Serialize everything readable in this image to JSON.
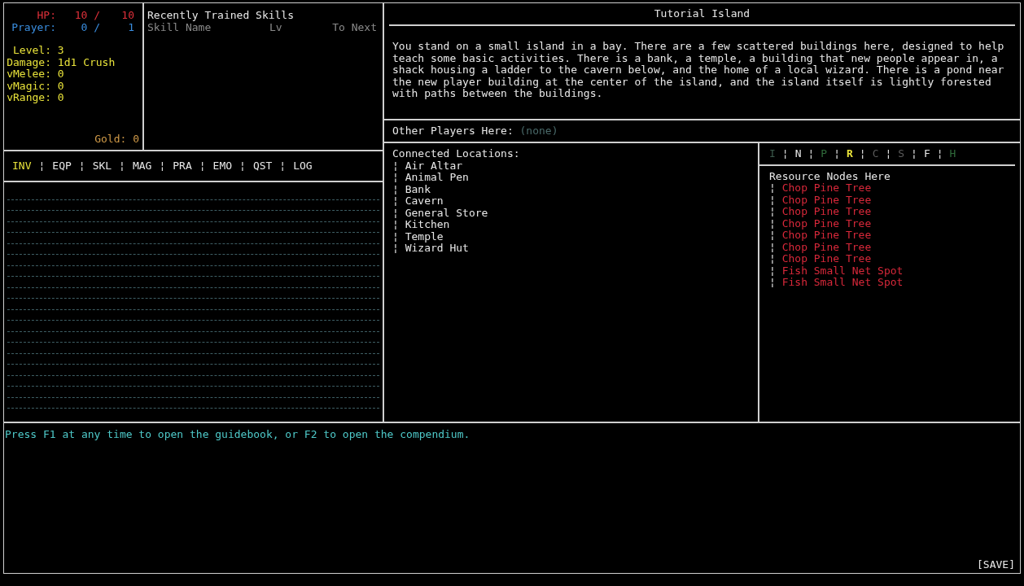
{
  "stats": {
    "hp": {
      "label": "HP:",
      "current": "10 /",
      "max": "10"
    },
    "prayer": {
      "label": "Prayer:",
      "current": "0 /",
      "max": "1"
    },
    "attributes": [
      {
        "label": "Level:",
        "value": "3"
      },
      {
        "label": "Damage:",
        "value": "1d1 Crush"
      },
      {
        "label": "vMelee:",
        "value": "0"
      },
      {
        "label": "vMagic:",
        "value": "0"
      },
      {
        "label": "vRange:",
        "value": "0"
      }
    ],
    "gold": {
      "label": "Gold:",
      "value": "0"
    }
  },
  "skills": {
    "title": "Recently Trained Skills",
    "columns": [
      "Skill Name",
      "Lv",
      "To Next"
    ]
  },
  "tabs": {
    "separator": "¦",
    "items": [
      {
        "label": "INV",
        "selected": true
      },
      {
        "label": "EQP",
        "selected": false
      },
      {
        "label": "SKL",
        "selected": false
      },
      {
        "label": "MAG",
        "selected": false
      },
      {
        "label": "PRA",
        "selected": false
      },
      {
        "label": "EMO",
        "selected": false
      },
      {
        "label": "QST",
        "selected": false
      },
      {
        "label": "LOG",
        "selected": false
      }
    ]
  },
  "location": {
    "title": "Tutorial Island",
    "description": "You stand on a small island in a bay. There are a few scattered buildings here, designed to help teach some basic activities. There is a bank, a temple, a building that new people appear in, a shack housing a ladder to the cavern below, and the home of a local wizard. There is a pond near the new player building at the center of the island, and the island itself is lightly forested with paths between the buildings.",
    "players_label": "Other Players Here:",
    "players_value": "(none)"
  },
  "connections": {
    "title": "Connected Locations:",
    "marker": "¦",
    "items": [
      "Air Altar",
      "Animal Pen",
      "Bank",
      "Cavern",
      "General Store",
      "Kitchen",
      "Temple",
      "Wizard Hut"
    ]
  },
  "filters": {
    "separator": "¦",
    "items": [
      {
        "label": "I",
        "color": "#3c5a4c",
        "selected": false
      },
      {
        "label": "N",
        "color": "#e8e8e8",
        "selected": false
      },
      {
        "label": "P",
        "color": "#2f6a3a",
        "selected": false
      },
      {
        "label": "R",
        "color": "#e8e23a",
        "selected": true
      },
      {
        "label": "C",
        "color": "#5a5a5a",
        "selected": false
      },
      {
        "label": "S",
        "color": "#5a5a5a",
        "selected": false
      },
      {
        "label": "F",
        "color": "#e8e8e8",
        "selected": false
      },
      {
        "label": "H",
        "color": "#2f6a3a",
        "selected": false
      }
    ]
  },
  "resources": {
    "title": "Resource Nodes Here",
    "marker": "¦",
    "items": [
      "Chop Pine Tree",
      "Chop Pine Tree",
      "Chop Pine Tree",
      "Chop Pine Tree",
      "Chop Pine Tree",
      "Chop Pine Tree",
      "Chop Pine Tree",
      "Fish Small Net Spot",
      "Fish Small Net Spot"
    ]
  },
  "messages": [
    "Press F1 at any time to open the guidebook, or F2 to open the compendium."
  ],
  "save_label": "[SAVE]"
}
